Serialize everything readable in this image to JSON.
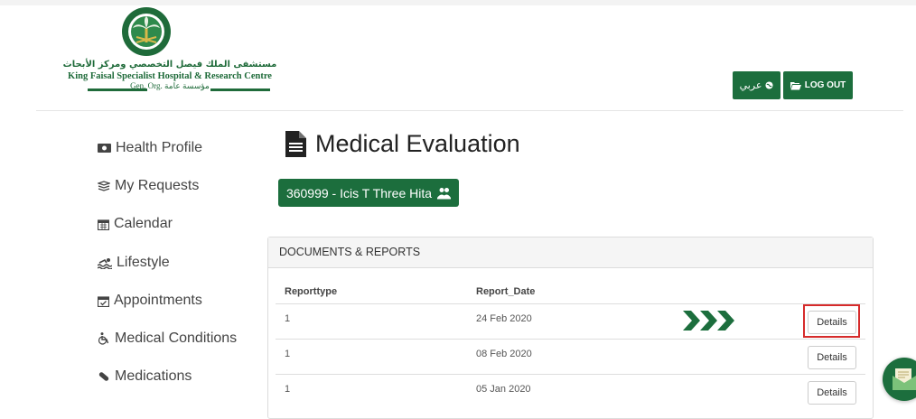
{
  "header": {
    "logo_arabic": "مستشفى الملك فيصل التخصصي ومركز الأبحاث",
    "logo_english": "King Faisal Specialist Hospital & Research Centre",
    "logo_gen": "Gen. Org. مؤسسة عامة",
    "language_button": "عربي",
    "logout_button": "LOG OUT",
    "brand_color": "#1c6e3d"
  },
  "sidebar": {
    "items": [
      {
        "label": "Health Profile",
        "icon": "id-card-icon"
      },
      {
        "label": "My Requests",
        "icon": "requests-icon"
      },
      {
        "label": "Calendar",
        "icon": "calendar-icon"
      },
      {
        "label": "Lifestyle",
        "icon": "swimmer-icon"
      },
      {
        "label": "Appointments",
        "icon": "calendar-check-icon"
      },
      {
        "label": "Medical Conditions",
        "icon": "wheelchair-icon"
      },
      {
        "label": "Medications",
        "icon": "pill-icon"
      }
    ]
  },
  "main": {
    "title": "Medical Evaluation",
    "patient_button": "360999 - Icis T Three Hita",
    "panel_title": "DOCUMENTS & REPORTS",
    "columns": [
      "Reporttype",
      "Report_Date"
    ],
    "rows": [
      {
        "type": "1",
        "date": "24 Feb 2020",
        "action": "Details"
      },
      {
        "type": "1",
        "date": "08 Feb 2020",
        "action": "Details"
      },
      {
        "type": "1",
        "date": "05 Jan 2020",
        "action": "Details"
      }
    ]
  },
  "annotation_color": "#d62b2b"
}
